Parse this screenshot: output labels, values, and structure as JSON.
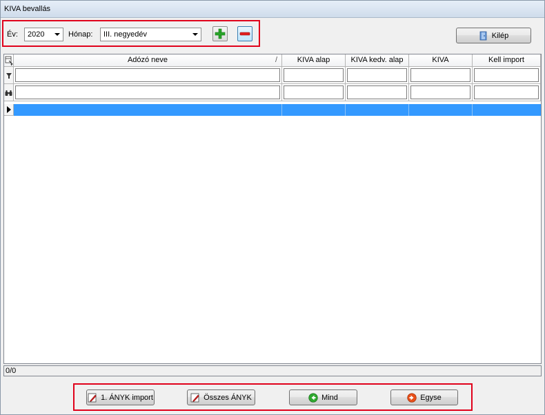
{
  "window": {
    "title": "KIVA bevallás"
  },
  "toolbar": {
    "year_label": "Év:",
    "year_value": "2020",
    "month_label": "Hónap:",
    "month_value": "III. negyedév",
    "exit_label": "Kilép"
  },
  "grid": {
    "columns": [
      "Adózó neve",
      "KIVA alap",
      "KIVA kedv. alap",
      "KIVA",
      "Kell import"
    ],
    "sort_indicator": "/"
  },
  "status": {
    "record_count": "0/0"
  },
  "bottom": {
    "anyk_import_label": "1. ÁNYK import",
    "all_anyk_label": "Összes ÁNYK",
    "all_label": "Mind",
    "single_label": "Egyse"
  },
  "colors": {
    "selection": "#3399ff",
    "highlight_frame": "#e0001a"
  }
}
